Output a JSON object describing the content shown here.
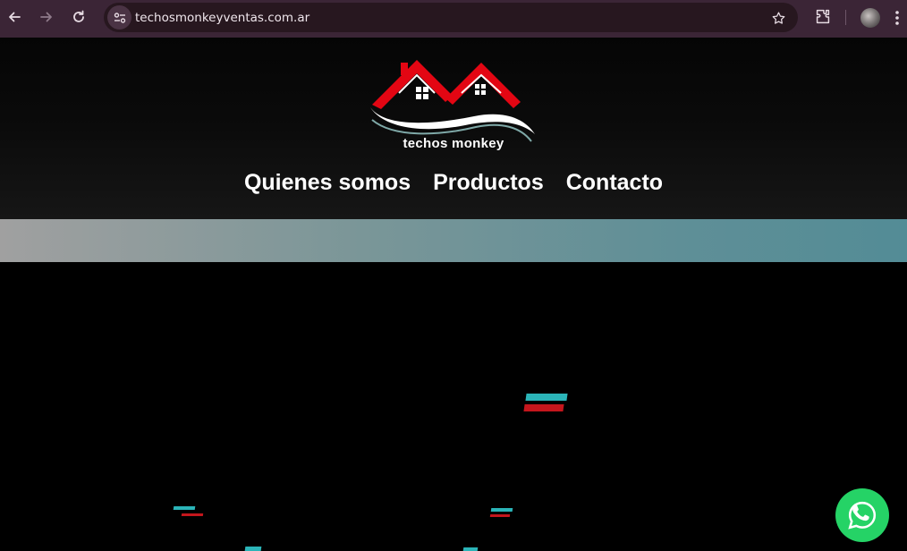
{
  "browser": {
    "url": "techosmonkeyventas.com.ar",
    "icons": [
      "back-arrow-icon",
      "forward-arrow-icon",
      "reload-icon",
      "site-info-icon",
      "bookmark-star-icon",
      "extensions-icon",
      "profile-avatar",
      "more-menu-icon"
    ]
  },
  "header": {
    "logo_text": "techos monkey",
    "nav": [
      {
        "label": "Quienes somos"
      },
      {
        "label": "Productos"
      },
      {
        "label": "Contacto"
      }
    ]
  },
  "colors": {
    "chrome_bg": "#3b2536",
    "omnibox_bg": "#27171f",
    "roof_red": "#e30613",
    "band_start": "#a0a0a0",
    "band_end": "#538c96",
    "whatsapp_green": "#25d366",
    "glitch_cyan": "#2bb4b8",
    "glitch_red": "#c4161c"
  },
  "floating": {
    "whatsapp_icon": "whatsapp-icon"
  }
}
